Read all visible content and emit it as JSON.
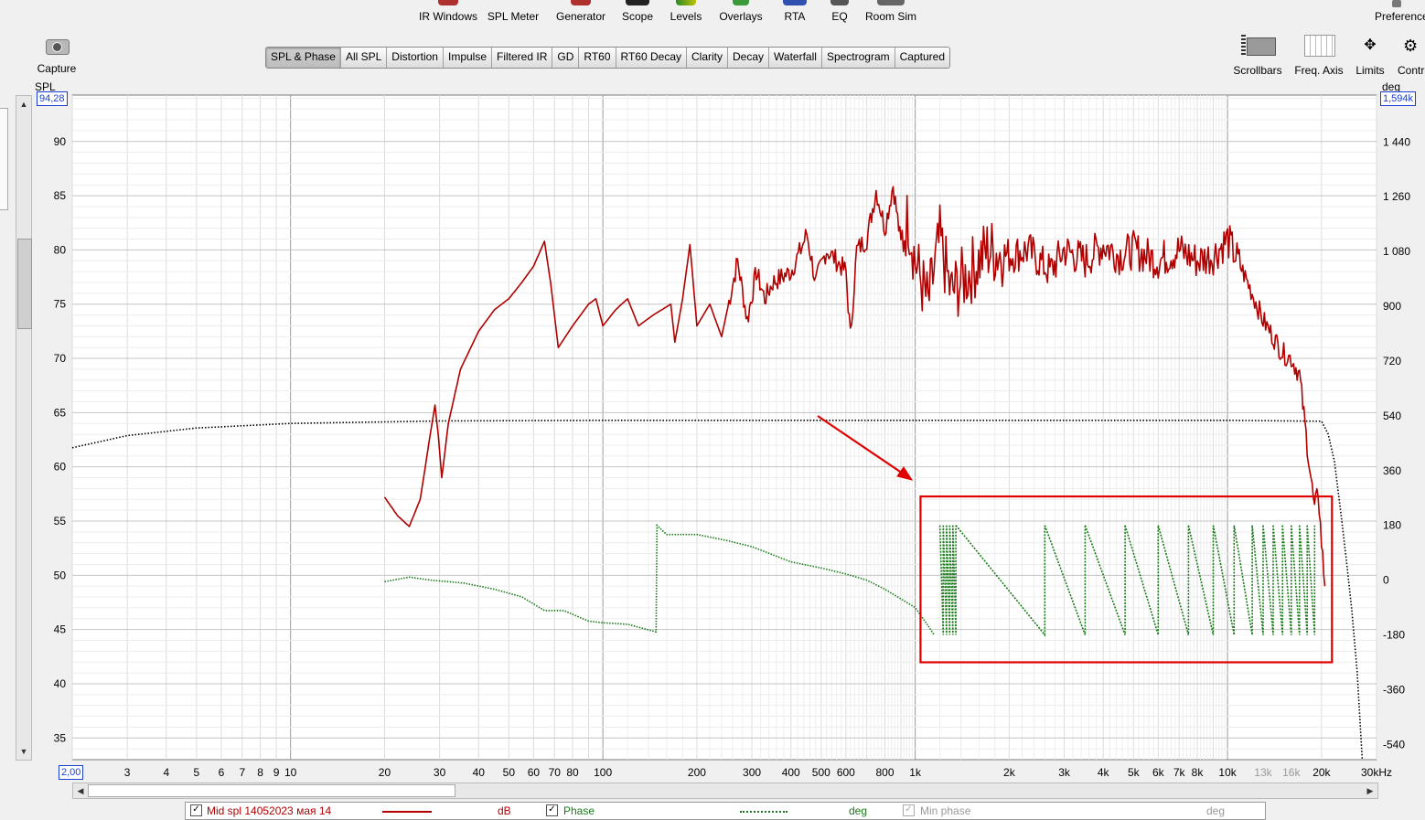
{
  "toolbar": {
    "items": [
      {
        "label": "IR Windows",
        "icon": "ir-windows-icon"
      },
      {
        "label": "SPL Meter",
        "icon": "spl-meter-icon"
      },
      {
        "label": "Generator",
        "icon": "generator-icon"
      },
      {
        "label": "Scope",
        "icon": "scope-icon"
      },
      {
        "label": "Levels",
        "icon": "levels-icon"
      },
      {
        "label": "Overlays",
        "icon": "overlays-icon"
      },
      {
        "label": "RTA",
        "icon": "rta-icon"
      },
      {
        "label": "EQ",
        "icon": "eq-icon"
      },
      {
        "label": "Room Sim",
        "icon": "room-sim-icon"
      }
    ],
    "preferences_label": "Preferences",
    "capture_label": "Capture"
  },
  "tabs": [
    {
      "label": "SPL & Phase",
      "active": true
    },
    {
      "label": "All SPL"
    },
    {
      "label": "Distortion"
    },
    {
      "label": "Impulse"
    },
    {
      "label": "Filtered IR"
    },
    {
      "label": "GD"
    },
    {
      "label": "RT60"
    },
    {
      "label": "RT60 Decay"
    },
    {
      "label": "Clarity"
    },
    {
      "label": "Decay"
    },
    {
      "label": "Waterfall"
    },
    {
      "label": "Spectrogram"
    },
    {
      "label": "Captured"
    }
  ],
  "right_tools": {
    "scrollbars_label": "Scrollbars",
    "freq_axis_label": "Freq. Axis",
    "limits_label": "Limits",
    "controls_label": "Contr"
  },
  "plot": {
    "left_unit": "SPL",
    "right_unit": "deg",
    "left_top_value": "94,28",
    "right_top_value": "1,594k",
    "x_left_value": "2,00",
    "x_right_label": "30kHz"
  },
  "chart_data": {
    "type": "line",
    "x_scale": "log",
    "xlim": [
      2,
      30000
    ],
    "ylim_left": [
      33,
      94.28
    ],
    "ylim_right": [
      -590,
      1594
    ],
    "left_ticks": [
      35,
      40,
      45,
      50,
      55,
      60,
      65,
      70,
      75,
      80,
      85,
      90
    ],
    "right_ticks": [
      "-540",
      "-360",
      "-180",
      "0",
      "180",
      "360",
      "540",
      "720",
      "900",
      "1 080",
      "1 260",
      "1 440"
    ],
    "right_tick_values": [
      -540,
      -360,
      -180,
      0,
      180,
      360,
      540,
      720,
      900,
      1080,
      1260,
      1440
    ],
    "x_ticks": [
      {
        "v": 3,
        "t": "3"
      },
      {
        "v": 4,
        "t": "4"
      },
      {
        "v": 5,
        "t": "5"
      },
      {
        "v": 6,
        "t": "6"
      },
      {
        "v": 7,
        "t": "7"
      },
      {
        "v": 8,
        "t": "8"
      },
      {
        "v": 9,
        "t": "9"
      },
      {
        "v": 10,
        "t": "10"
      },
      {
        "v": 20,
        "t": "20"
      },
      {
        "v": 30,
        "t": "30"
      },
      {
        "v": 40,
        "t": "40"
      },
      {
        "v": 50,
        "t": "50"
      },
      {
        "v": 60,
        "t": "60"
      },
      {
        "v": 70,
        "t": "70"
      },
      {
        "v": 80,
        "t": "80"
      },
      {
        "v": 100,
        "t": "100"
      },
      {
        "v": 200,
        "t": "200"
      },
      {
        "v": 300,
        "t": "300"
      },
      {
        "v": 400,
        "t": "400"
      },
      {
        "v": 500,
        "t": "500"
      },
      {
        "v": 600,
        "t": "600"
      },
      {
        "v": 800,
        "t": "800"
      },
      {
        "v": 1000,
        "t": "1k"
      },
      {
        "v": 2000,
        "t": "2k"
      },
      {
        "v": 3000,
        "t": "3k"
      },
      {
        "v": 4000,
        "t": "4k"
      },
      {
        "v": 5000,
        "t": "5k"
      },
      {
        "v": 6000,
        "t": "6k"
      },
      {
        "v": 7000,
        "t": "7k"
      },
      {
        "v": 8000,
        "t": "8k"
      },
      {
        "v": 10000,
        "t": "10k"
      },
      {
        "v": 13000,
        "t": "13k",
        "dim": true
      },
      {
        "v": 16000,
        "t": "16k",
        "dim": true
      },
      {
        "v": 20000,
        "t": "20k"
      }
    ],
    "series": [
      {
        "name": "Mid spl 14052023 мая 14",
        "axis": "left",
        "color": "#b00000",
        "points": [
          [
            20,
            57.2
          ],
          [
            22,
            55.5
          ],
          [
            24,
            54.5
          ],
          [
            26,
            57
          ],
          [
            27,
            60
          ],
          [
            28,
            63
          ],
          [
            29,
            65.7
          ],
          [
            29.7,
            63
          ],
          [
            30.5,
            59
          ],
          [
            32,
            64
          ],
          [
            35,
            69
          ],
          [
            40,
            72.5
          ],
          [
            45,
            74.5
          ],
          [
            50,
            75.5
          ],
          [
            55,
            77
          ],
          [
            60,
            78.5
          ],
          [
            65,
            80.8
          ],
          [
            68,
            77
          ],
          [
            72,
            71
          ],
          [
            80,
            73
          ],
          [
            90,
            75
          ],
          [
            95,
            75.5
          ],
          [
            100,
            73
          ],
          [
            110,
            74.5
          ],
          [
            120,
            75.5
          ],
          [
            130,
            73
          ],
          [
            145,
            74
          ],
          [
            165,
            75
          ],
          [
            170,
            71.5
          ],
          [
            180,
            75.5
          ],
          [
            190,
            80.5
          ],
          [
            200,
            73
          ],
          [
            220,
            75
          ],
          [
            240,
            72
          ],
          [
            270,
            79
          ],
          [
            290,
            73.5
          ],
          [
            310,
            78
          ],
          [
            330,
            75.5
          ],
          [
            350,
            77
          ],
          [
            400,
            78
          ],
          [
            430,
            80
          ],
          [
            450,
            81.5
          ],
          [
            480,
            77
          ],
          [
            520,
            80
          ],
          [
            560,
            79
          ],
          [
            600,
            78
          ],
          [
            620,
            72
          ],
          [
            650,
            80
          ],
          [
            700,
            81
          ],
          [
            750,
            85.5
          ],
          [
            800,
            82
          ],
          [
            850,
            86
          ],
          [
            900,
            80.5
          ],
          [
            950,
            83
          ],
          [
            1000,
            79
          ],
          [
            1100,
            75
          ],
          [
            1200,
            81
          ],
          [
            1300,
            76
          ],
          [
            1500,
            78
          ],
          [
            1700,
            80
          ],
          [
            2000,
            79.5
          ],
          [
            2300,
            80
          ],
          [
            2700,
            78
          ],
          [
            3000,
            80
          ],
          [
            3500,
            79
          ],
          [
            4000,
            80.5
          ],
          [
            4500,
            79.5
          ],
          [
            5000,
            80
          ],
          [
            6000,
            79
          ],
          [
            7000,
            80
          ],
          [
            8000,
            79
          ],
          [
            9000,
            79.5
          ],
          [
            10000,
            81
          ],
          [
            11000,
            78.5
          ],
          [
            12000,
            76
          ],
          [
            13000,
            73.5
          ],
          [
            14000,
            72
          ],
          [
            15000,
            70.5
          ],
          [
            16000,
            70
          ],
          [
            17000,
            68.5
          ],
          [
            18000,
            62
          ],
          [
            19000,
            56
          ],
          [
            19500,
            57.8
          ],
          [
            20000,
            53
          ],
          [
            20500,
            49
          ]
        ]
      },
      {
        "name": "Phase",
        "axis": "right",
        "color": "#1a7a1a",
        "points": [
          [
            20,
            -5
          ],
          [
            24,
            10
          ],
          [
            28,
            0
          ],
          [
            32,
            -5
          ],
          [
            36,
            -10
          ],
          [
            45,
            -30
          ],
          [
            55,
            -55
          ],
          [
            65,
            -100
          ],
          [
            75,
            -100
          ],
          [
            90,
            -135
          ],
          [
            100,
            -140
          ],
          [
            120,
            -145
          ],
          [
            148,
            -170
          ],
          [
            149,
            180
          ],
          [
            160,
            150
          ],
          [
            200,
            150
          ],
          [
            250,
            130
          ],
          [
            300,
            110
          ],
          [
            400,
            60
          ],
          [
            500,
            40
          ],
          [
            600,
            20
          ],
          [
            700,
            0
          ],
          [
            800,
            -30
          ],
          [
            1000,
            -90
          ],
          [
            1100,
            -150
          ],
          [
            1150,
            -180
          ]
        ]
      },
      {
        "name": "Min phase",
        "axis": "right",
        "color": "#000000",
        "dotted": true,
        "points": [
          [
            2,
            435
          ],
          [
            3,
            475
          ],
          [
            5,
            500
          ],
          [
            10,
            515
          ],
          [
            30,
            523
          ],
          [
            100,
            525
          ],
          [
            1000,
            525
          ],
          [
            10000,
            525
          ],
          [
            20000,
            522
          ],
          [
            21000,
            480
          ],
          [
            22000,
            390
          ],
          [
            23000,
            230
          ],
          [
            24000,
            70
          ],
          [
            25000,
            -100
          ],
          [
            26000,
            -300
          ],
          [
            27000,
            -590
          ]
        ]
      }
    ],
    "annotations": [
      {
        "type": "highlight-rect",
        "color": "#e00000"
      },
      {
        "type": "arrow",
        "color": "#e00000"
      }
    ]
  },
  "legend": {
    "spl_name": "Mid spl 14052023 мая 14",
    "spl_unit": "dB",
    "phase_label": "Phase",
    "phase_unit": "deg",
    "minphase_label": "Min phase",
    "minphase_unit": "deg"
  }
}
